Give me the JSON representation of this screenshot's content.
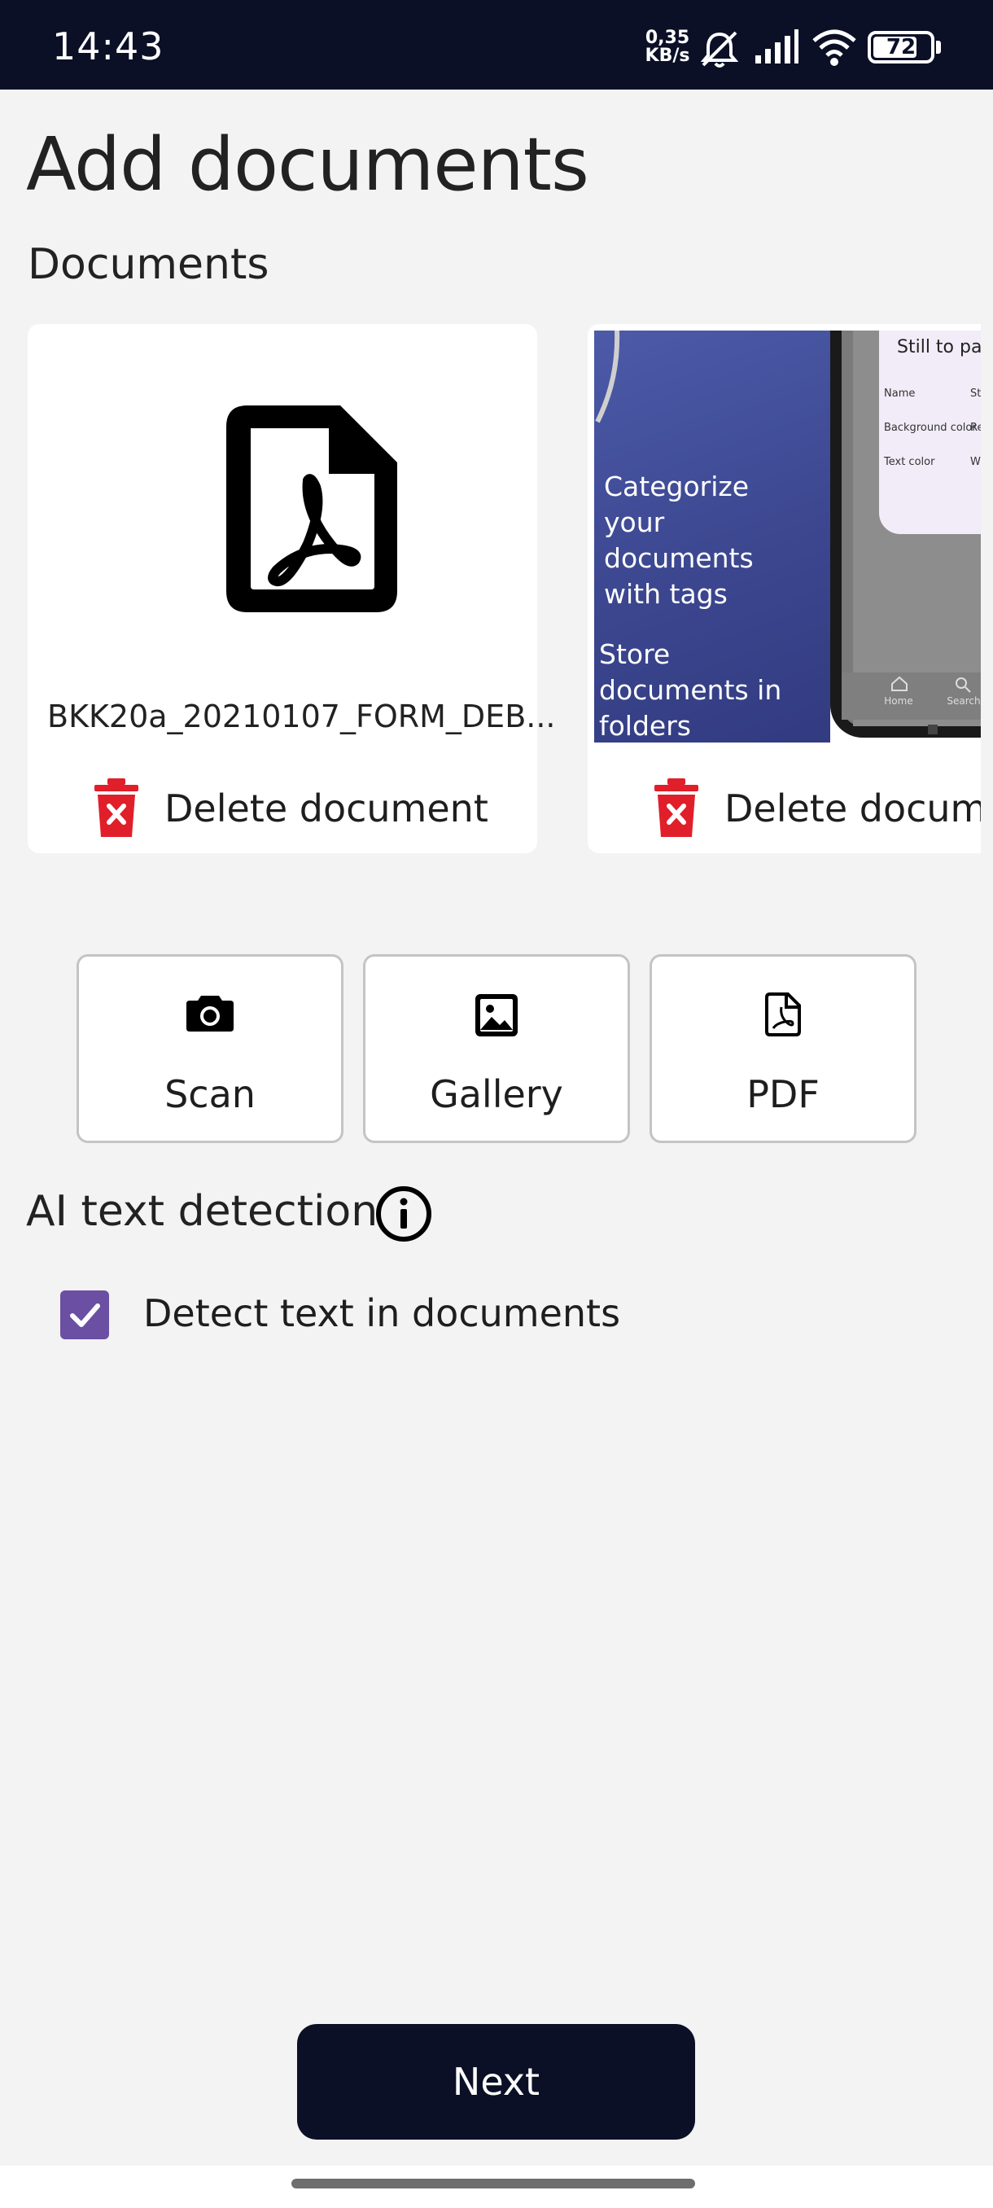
{
  "status_bar": {
    "time": "14:43",
    "speed_value": "0,35",
    "speed_unit": "KB/s",
    "battery": "72",
    "icons": [
      "mute-icon",
      "signal-icon",
      "wifi-icon",
      "battery-icon"
    ]
  },
  "page": {
    "title": "Add documents",
    "documents_heading": "Documents"
  },
  "documents": [
    {
      "filename": "BKK20a_20210107_FORM_DEB...",
      "thumbnail": "pdf-file-icon",
      "delete_label": "Delete document"
    },
    {
      "thumbnail": "promo-screenshot",
      "promo_text_1": "Categorize your documents with tags",
      "promo_text_2": "Store documents in folders",
      "panel_title": "Still to pay",
      "panel_rows": [
        "Name",
        "Background color",
        "Text color"
      ],
      "panel_values": [
        "St",
        "Re",
        "W"
      ],
      "nav_home": "Home",
      "nav_search": "Search",
      "delete_label": "Delete document"
    }
  ],
  "sources": {
    "scan_label": "Scan",
    "gallery_label": "Gallery",
    "pdf_label": "PDF"
  },
  "ai": {
    "heading": "AI text detection",
    "checkbox_label": "Detect text in documents",
    "checked": true
  },
  "footer": {
    "next_label": "Next"
  },
  "colors": {
    "navy": "#0b1027",
    "accent_purple": "#6a4fa3",
    "delete_red": "#e01f2a",
    "background": "#f3f3f3"
  }
}
